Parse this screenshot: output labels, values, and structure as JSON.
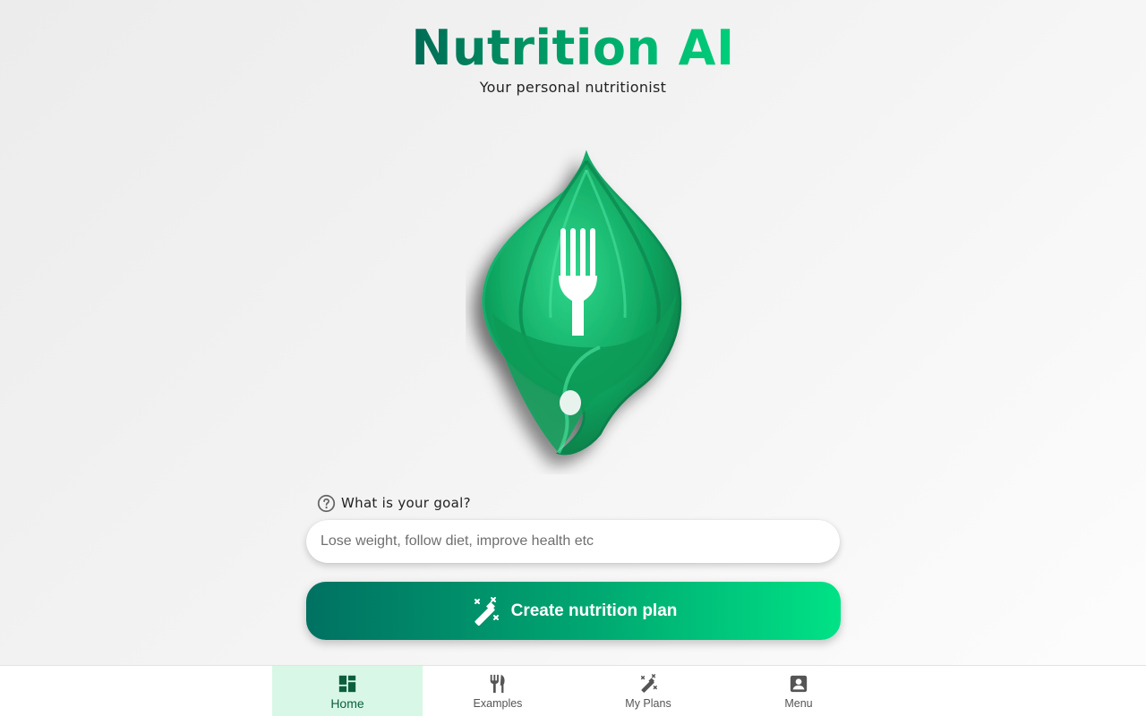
{
  "app": {
    "title": "Nutrition AI",
    "subtitle": "Your personal nutritionist"
  },
  "logo": {
    "icon": "leaf-fork-logo"
  },
  "goal": {
    "label": "What is your goal?",
    "help_icon": "question-circle-icon",
    "value": "",
    "placeholder": "Lose weight, follow diet, improve health etc"
  },
  "cta": {
    "label": "Create nutrition plan",
    "icon": "magic-wand-icon"
  },
  "nav": {
    "items": [
      {
        "label": "Home",
        "icon": "dashboard-icon",
        "active": true
      },
      {
        "label": "Examples",
        "icon": "utensils-icon",
        "active": false
      },
      {
        "label": "My Plans",
        "icon": "magic-wand-icon",
        "active": false
      },
      {
        "label": "Menu",
        "icon": "account-box-icon",
        "active": false
      }
    ]
  },
  "colors": {
    "brand_dark": "#006b55",
    "brand_light": "#00e286",
    "active_nav_bg": "#d8f7e6",
    "active_nav_text": "#0b5f3c"
  }
}
